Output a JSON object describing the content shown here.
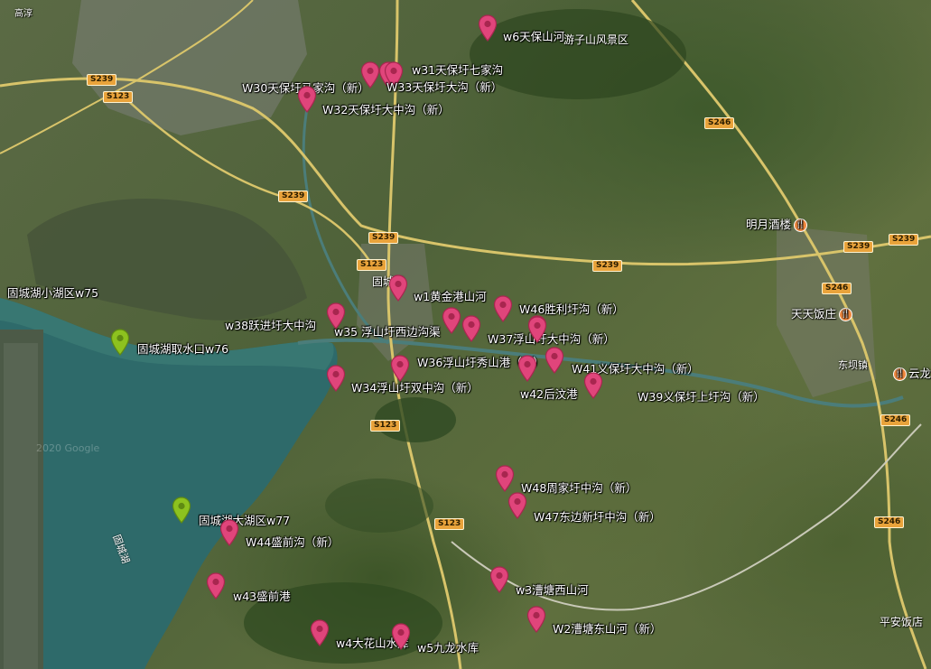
{
  "map": {
    "lake_label": "固城湖",
    "watermark": "Map data ©2020 Google",
    "watermark_short": "2020 Google"
  },
  "road_shields": [
    {
      "id": "S239a",
      "label": "S239"
    },
    {
      "id": "S123a",
      "label": "S123"
    },
    {
      "id": "S239b",
      "label": "S239"
    },
    {
      "id": "S246a",
      "label": "S246"
    },
    {
      "id": "S239c",
      "label": "S239"
    },
    {
      "id": "S123b",
      "label": "S123"
    },
    {
      "id": "S239d",
      "label": "S239"
    },
    {
      "id": "S239e",
      "label": "S239"
    },
    {
      "id": "S239f",
      "label": "S239"
    },
    {
      "id": "S246b",
      "label": "S246"
    },
    {
      "id": "S123c",
      "label": "S123"
    },
    {
      "id": "S123d",
      "label": "S123"
    },
    {
      "id": "S246c",
      "label": "S246"
    },
    {
      "id": "S246d",
      "label": "S246"
    }
  ],
  "places": [
    {
      "id": "scenic",
      "label": "游子山风景区"
    },
    {
      "id": "guchengzhen",
      "label": "固城镇"
    },
    {
      "id": "dongba",
      "label": "东坝镇"
    },
    {
      "id": "pingan",
      "label": "平安饭店"
    },
    {
      "id": "gaochun_top",
      "label": "高淳"
    }
  ],
  "pois": [
    {
      "id": "mingyue",
      "label": "明月酒楼",
      "icon": "restaurant-icon"
    },
    {
      "id": "tiantian",
      "label": "天天饭庄",
      "icon": "restaurant-icon"
    },
    {
      "id": "yunlong",
      "label": "云龙",
      "icon": "restaurant-icon"
    }
  ],
  "markers": [
    {
      "id": "w6",
      "label": "w6天保山河",
      "color": "#e0457b"
    },
    {
      "id": "w31",
      "label": "w31天保圩七家沟",
      "color": "#e0457b"
    },
    {
      "id": "w30",
      "label": "W30天保圩马家沟（新）",
      "color": "#e0457b"
    },
    {
      "id": "w33",
      "label": "W33天保圩大沟（新）",
      "color": "#e0457b"
    },
    {
      "id": "w32",
      "label": "W32天保圩大中沟（新）",
      "color": "#e0457b"
    },
    {
      "id": "w75",
      "label": "固城湖小湖区w75",
      "color": "none"
    },
    {
      "id": "w1",
      "label": "w1黄金港山河",
      "color": "#e0457b"
    },
    {
      "id": "w46",
      "label": "W46胜利圩沟（新）",
      "color": "#e0457b"
    },
    {
      "id": "w38",
      "label": "w38跃进圩大中沟",
      "color": "#e0457b"
    },
    {
      "id": "w35",
      "label": "w35 浮山圩西边沟渠",
      "color": "#e0457b"
    },
    {
      "id": "w37",
      "label": "W37浮山圩大中沟（新）",
      "color": "#e0457b"
    },
    {
      "id": "w76",
      "label": "固城湖取水口w76",
      "color": "#8dc21f"
    },
    {
      "id": "w36",
      "label": "W36浮山圩秀山港（新）",
      "color": "#e0457b"
    },
    {
      "id": "w41",
      "label": "W41义保圩大中沟（新）",
      "color": "#e0457b"
    },
    {
      "id": "w34",
      "label": "W34浮山圩双中沟（新）",
      "color": "#e0457b"
    },
    {
      "id": "w42",
      "label": "w42后汶港",
      "color": "#e0457b"
    },
    {
      "id": "w39",
      "label": "W39义保圩上圩沟（新）",
      "color": "#e0457b"
    },
    {
      "id": "w48",
      "label": "W48周家圩中沟（新）",
      "color": "#e0457b"
    },
    {
      "id": "w47",
      "label": "W47东边新圩中沟（新）",
      "color": "#e0457b"
    },
    {
      "id": "w77",
      "label": "固城湖大湖区w77",
      "color": "#8dc21f"
    },
    {
      "id": "w44",
      "label": "W44盛前沟（新）",
      "color": "#e0457b"
    },
    {
      "id": "w43",
      "label": "w43盛前港",
      "color": "#e0457b"
    },
    {
      "id": "w3",
      "label": "w3漕塘西山河",
      "color": "#e0457b"
    },
    {
      "id": "w2",
      "label": "W2漕塘东山河（新）",
      "color": "#e0457b"
    },
    {
      "id": "w4",
      "label": "w4大花山水库",
      "color": "#e0457b"
    },
    {
      "id": "w5",
      "label": "w5九龙水库",
      "color": "#e0457b"
    }
  ]
}
